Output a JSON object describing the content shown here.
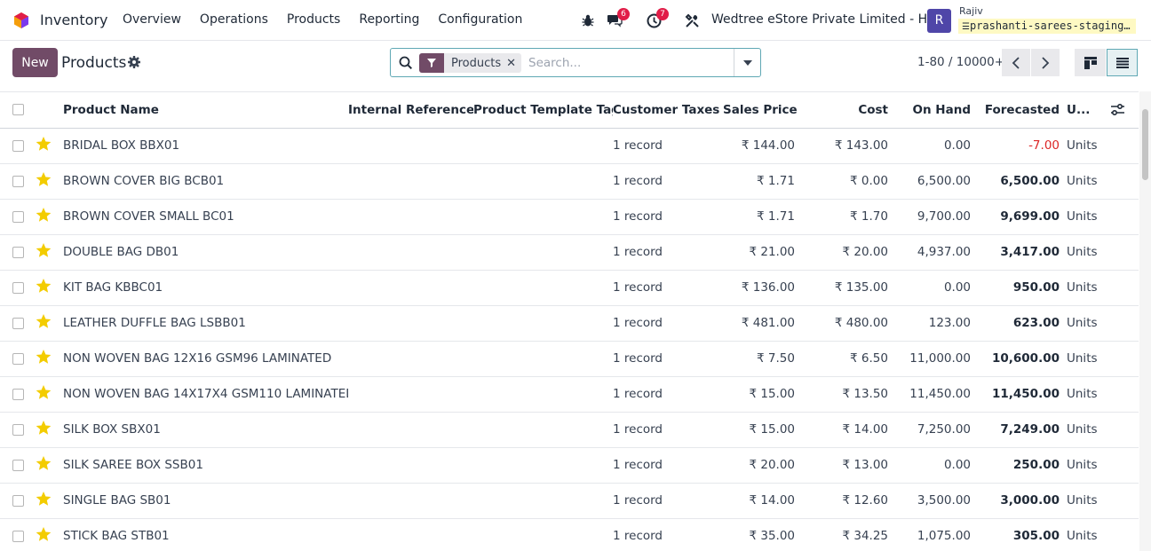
{
  "app": {
    "name": "Inventory",
    "menu": [
      "Overview",
      "Operations",
      "Products",
      "Reporting",
      "Configuration"
    ]
  },
  "systray": {
    "messages_count": "6",
    "activities_count": "7",
    "company": "Wedtree eStore Private Limited - HO",
    "avatar_initial": "R",
    "user": "Rajiv",
    "database": "prashanti-sarees-staging…"
  },
  "control": {
    "new_label": "New",
    "breadcrumb": "Products",
    "facet_label": "Products",
    "search_placeholder": "Search...",
    "pager": "1-80 / 10000+"
  },
  "columns": [
    "Product Name",
    "Internal Reference",
    "Product Template Tags",
    "Customer Taxes",
    "Sales Price",
    "Cost",
    "On Hand",
    "Forecasted",
    "U..."
  ],
  "rows": [
    {
      "name": "BRIDAL BOX BBX01",
      "taxes": "1 record",
      "price": "₹ 144.00",
      "cost": "₹ 143.00",
      "onhand": "0.00",
      "forecast": "-7.00",
      "uom": "Units"
    },
    {
      "name": "BROWN COVER BIG BCB01",
      "taxes": "1 record",
      "price": "₹ 1.71",
      "cost": "₹ 0.00",
      "onhand": "6,500.00",
      "forecast": "6,500.00",
      "uom": "Units"
    },
    {
      "name": "BROWN COVER SMALL BC01",
      "taxes": "1 record",
      "price": "₹ 1.71",
      "cost": "₹ 1.70",
      "onhand": "9,700.00",
      "forecast": "9,699.00",
      "uom": "Units"
    },
    {
      "name": "DOUBLE BAG DB01",
      "taxes": "1 record",
      "price": "₹ 21.00",
      "cost": "₹ 20.00",
      "onhand": "4,937.00",
      "forecast": "3,417.00",
      "uom": "Units"
    },
    {
      "name": "KIT BAG KBBC01",
      "taxes": "1 record",
      "price": "₹ 136.00",
      "cost": "₹ 135.00",
      "onhand": "0.00",
      "forecast": "950.00",
      "uom": "Units"
    },
    {
      "name": "LEATHER DUFFLE BAG LSBB01",
      "taxes": "1 record",
      "price": "₹ 481.00",
      "cost": "₹ 480.00",
      "onhand": "123.00",
      "forecast": "623.00",
      "uom": "Units"
    },
    {
      "name": "NON WOVEN BAG 12X16 GSM96 LAMINATED",
      "taxes": "1 record",
      "price": "₹ 7.50",
      "cost": "₹ 6.50",
      "onhand": "11,000.00",
      "forecast": "10,600.00",
      "uom": "Units"
    },
    {
      "name": "NON WOVEN BAG 14X17X4 GSM110 LAMINATED",
      "taxes": "1 record",
      "price": "₹ 15.00",
      "cost": "₹ 13.50",
      "onhand": "11,450.00",
      "forecast": "11,450.00",
      "uom": "Units"
    },
    {
      "name": "SILK BOX SBX01",
      "taxes": "1 record",
      "price": "₹ 15.00",
      "cost": "₹ 14.00",
      "onhand": "7,250.00",
      "forecast": "7,249.00",
      "uom": "Units"
    },
    {
      "name": "SILK SAREE BOX SSB01",
      "taxes": "1 record",
      "price": "₹ 20.00",
      "cost": "₹ 13.00",
      "onhand": "0.00",
      "forecast": "250.00",
      "uom": "Units"
    },
    {
      "name": "SINGLE BAG SB01",
      "taxes": "1 record",
      "price": "₹ 14.00",
      "cost": "₹ 12.60",
      "onhand": "3,500.00",
      "forecast": "3,000.00",
      "uom": "Units"
    },
    {
      "name": "STICK BAG STB01",
      "taxes": "1 record",
      "price": "₹ 35.00",
      "cost": "₹ 34.25",
      "onhand": "1,075.00",
      "forecast": "305.00",
      "uom": "Units"
    }
  ],
  "colors": {
    "brand": "#714b67",
    "star": "#f3cc00",
    "negative": "#dc2626",
    "badge": "#e11d48"
  }
}
